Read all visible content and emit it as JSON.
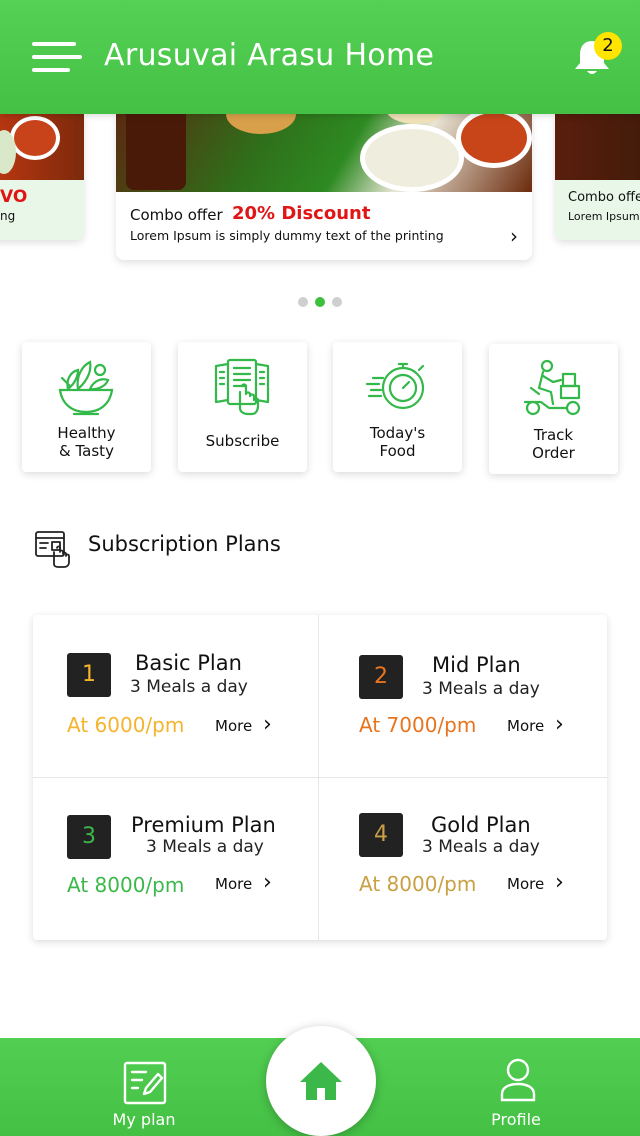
{
  "header": {
    "title": "Arusuvai Arasu Home",
    "notification_count": "2"
  },
  "carousel": {
    "center": {
      "combo": "Combo offer",
      "discount": "20% Discount",
      "description": "Lorem Ipsum is simply dummy text of the printing"
    },
    "left": {
      "red_text": "VO",
      "small_text": "ng"
    },
    "right": {
      "combo": "Combo offe",
      "lorem": "Lorem Ipsum"
    },
    "dots_count": 3,
    "active_dot": 1
  },
  "categories": [
    {
      "line1": "Healthy",
      "line2": "& Tasty"
    },
    {
      "line1": "Subscribe",
      "line2": ""
    },
    {
      "line1": "Today's",
      "line2": "Food"
    },
    {
      "line1": "Track",
      "line2": "Order"
    }
  ],
  "subscription": {
    "title": "Subscription Plans",
    "plans": [
      {
        "number": "1",
        "name": "Basic Plan",
        "meals": "3 Meals a day",
        "price_prefix": "At ",
        "price": "6000",
        "price_suffix": "/pm",
        "more": "More",
        "color": "#f4b42c"
      },
      {
        "number": "2",
        "name": "Mid Plan",
        "meals": "3 Meals a day",
        "price_prefix": "At ",
        "price": "7000",
        "price_suffix": "/pm",
        "more": "More",
        "color": "#e8741e"
      },
      {
        "number": "3",
        "name": "Premium Plan",
        "meals": "3 Meals a day",
        "price_prefix": "At ",
        "price": "8000",
        "price_suffix": "/pm",
        "more": "More",
        "color": "#3cb84a"
      },
      {
        "number": "4",
        "name": "Gold Plan",
        "meals": "3 Meals a day",
        "price_prefix": "At ",
        "price": "8000",
        "price_suffix": "/pm",
        "more": "More",
        "color": "#c9a043"
      }
    ]
  },
  "bottom_nav": {
    "my_plan": "My plan",
    "profile": "Profile"
  },
  "colors": {
    "brand_green": "#4cc94c",
    "discount_red": "#e01616",
    "badge_yellow": "#ffe400"
  }
}
